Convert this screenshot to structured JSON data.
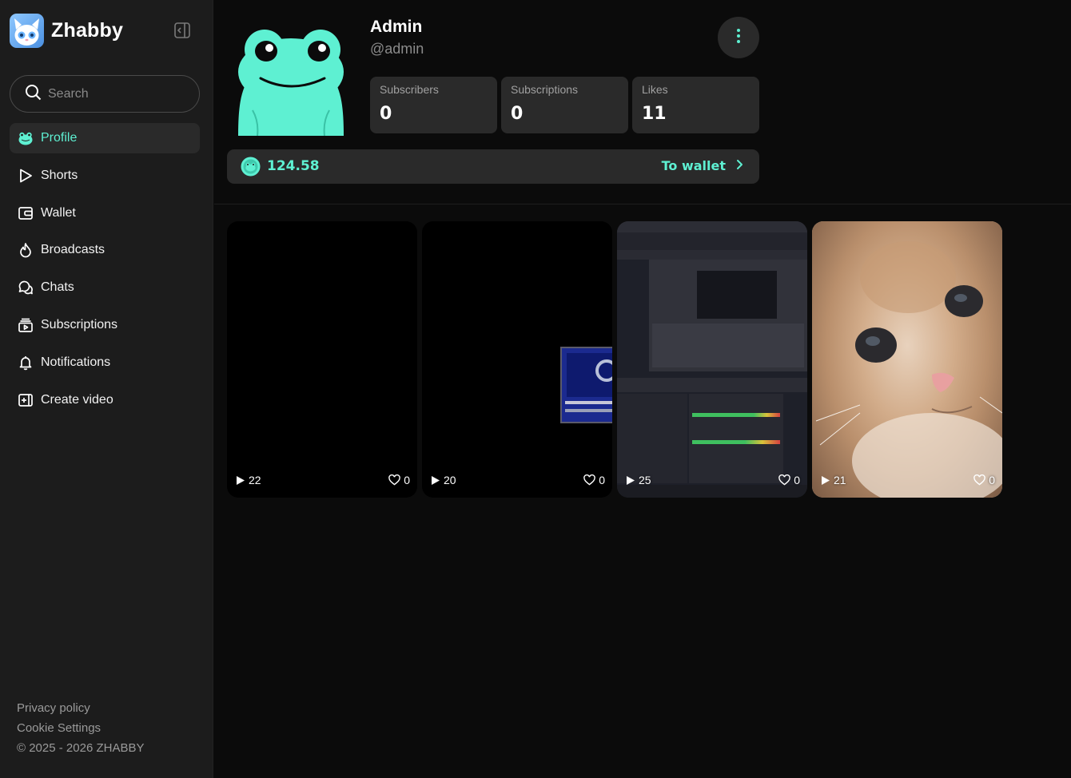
{
  "brand": {
    "name": "Zhabby"
  },
  "search": {
    "placeholder": "Search"
  },
  "nav": [
    {
      "label": "Profile",
      "icon": "frog-icon",
      "active": true
    },
    {
      "label": "Shorts",
      "icon": "play-icon"
    },
    {
      "label": "Wallet",
      "icon": "wallet-icon"
    },
    {
      "label": "Broadcasts",
      "icon": "flame-icon"
    },
    {
      "label": "Chats",
      "icon": "chat-icon"
    },
    {
      "label": "Subscriptions",
      "icon": "subscriptions-icon"
    },
    {
      "label": "Notifications",
      "icon": "bell-icon"
    },
    {
      "label": "Create video",
      "icon": "add-video-icon"
    }
  ],
  "footer": {
    "privacy": "Privacy policy",
    "cookies": "Cookie Settings",
    "copyright": "© 2025 - 2026 ZHABBY"
  },
  "profile": {
    "name": "Admin",
    "handle": "@admin",
    "stats": [
      {
        "label": "Subscribers",
        "value": "0"
      },
      {
        "label": "Subscriptions",
        "value": "0"
      },
      {
        "label": "Likes",
        "value": "11"
      }
    ],
    "balance": "124.58",
    "to_wallet": "To wallet"
  },
  "videos": [
    {
      "views": "22",
      "likes": "0",
      "thumb": "black"
    },
    {
      "views": "20",
      "likes": "0",
      "thumb": "black-with-window"
    },
    {
      "views": "25",
      "likes": "0",
      "thumb": "obs-screenshot"
    },
    {
      "views": "21",
      "likes": "0",
      "thumb": "cat-photo"
    }
  ],
  "colors": {
    "accent": "#5ef0d2",
    "sidebar_bg": "#1c1c1c",
    "main_bg": "#0b0b0b",
    "card_bg": "#2a2a2a"
  }
}
